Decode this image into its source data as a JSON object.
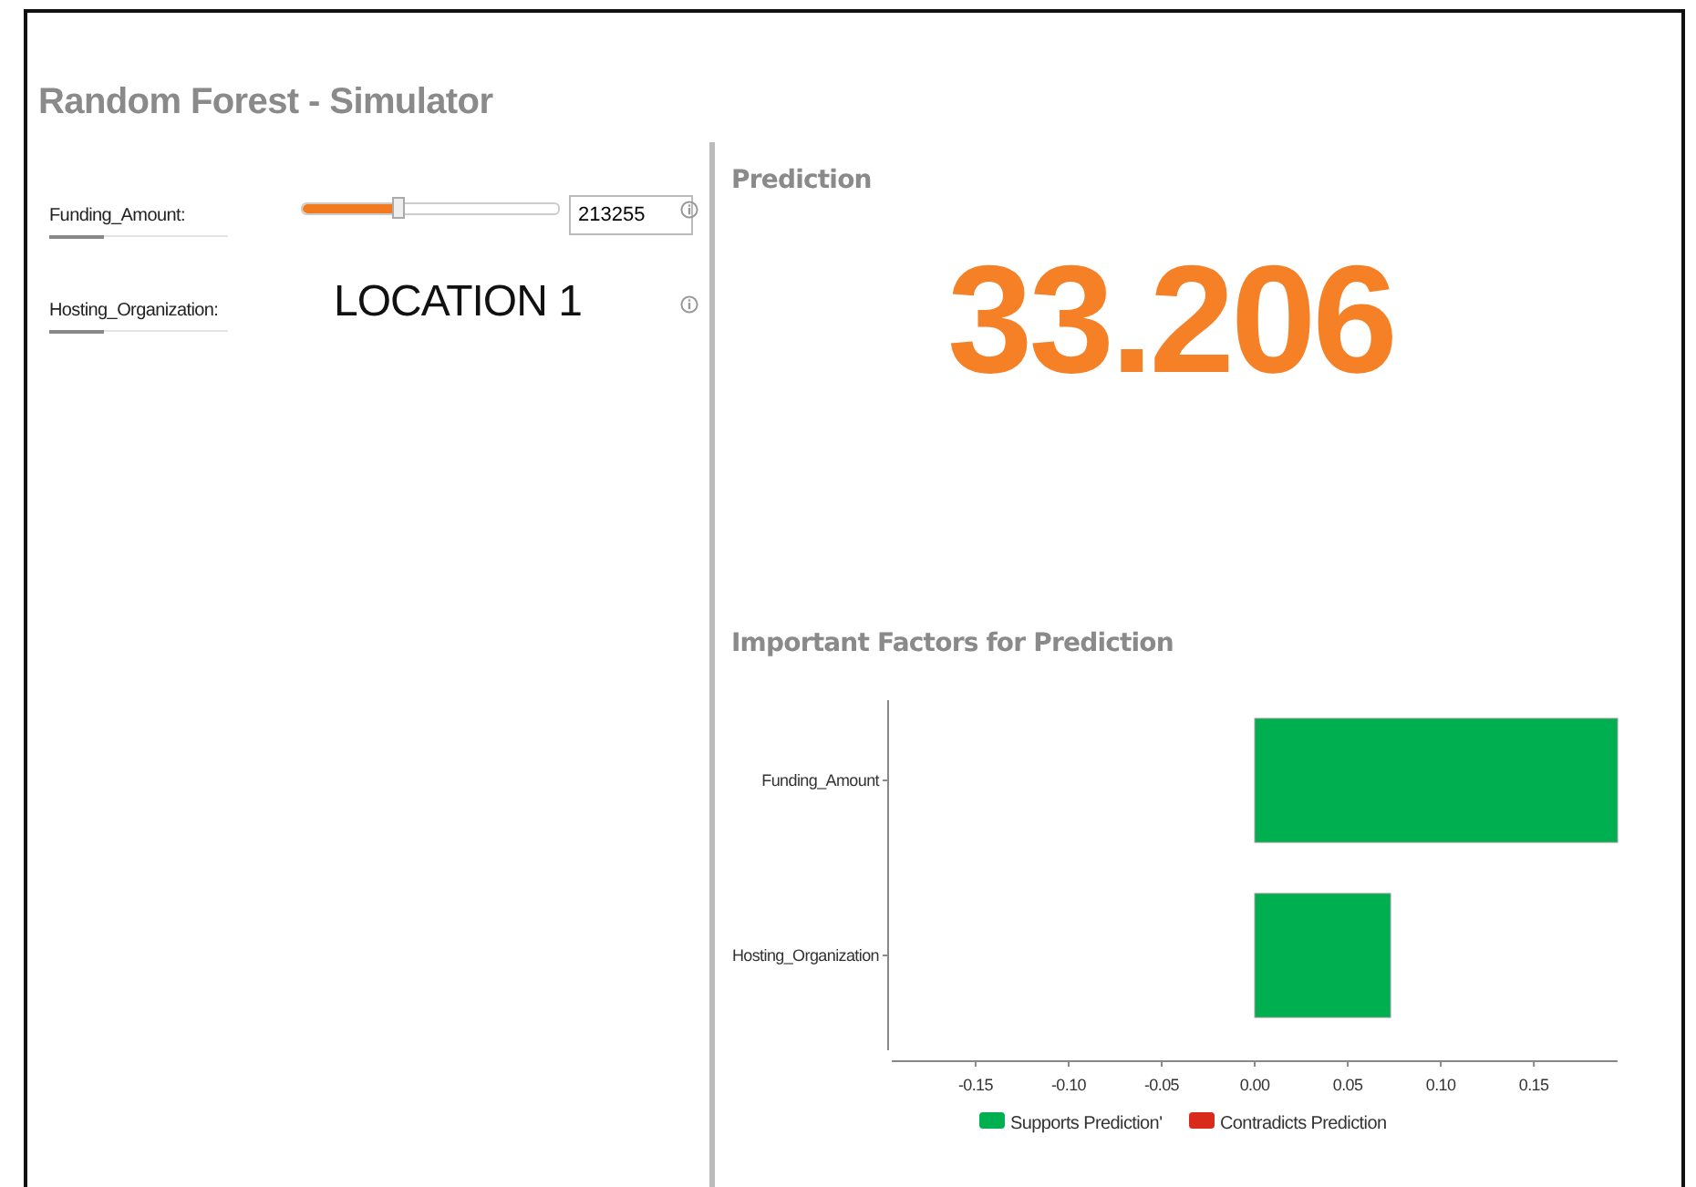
{
  "title": "Random Forest - Simulator",
  "inputs": [
    {
      "kind": "slider",
      "label": "Funding_Amount:",
      "level": 0.38,
      "value": "213255"
    },
    {
      "kind": "text",
      "label": "Hosting_Organization:",
      "value": "LOCATION 1"
    }
  ],
  "prediction": {
    "title": "Prediction",
    "value": "33.206"
  },
  "factors": {
    "title": "Important Factors for Prediction",
    "chart_data": {
      "type": "bar",
      "orientation": "horizontal",
      "categories": [
        "Funding_Amount",
        "Hosting_Organization"
      ],
      "series": [
        {
          "name": "Supports Prediction'",
          "color": "#00b050",
          "values": [
            0.195,
            0.073
          ]
        },
        {
          "name": "Contradicts Prediction",
          "color": "#d92b1c",
          "values": [
            null,
            null
          ]
        }
      ],
      "xlim": [
        -0.197,
        0.195
      ],
      "xticks": [
        {
          "value": -0.15,
          "label": "-0.15"
        },
        {
          "value": -0.1,
          "label": "-0.10"
        },
        {
          "value": -0.05,
          "label": "-0.05"
        },
        {
          "value": 0,
          "label": "0.00"
        },
        {
          "value": 0.05,
          "label": "0.05"
        },
        {
          "value": 0.1,
          "label": "0.10"
        },
        {
          "value": 0.15,
          "label": "0.15"
        }
      ]
    }
  }
}
